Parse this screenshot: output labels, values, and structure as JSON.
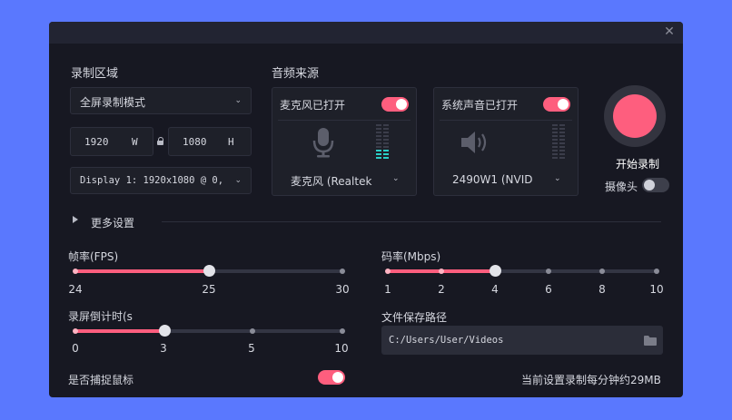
{
  "window": {
    "close_icon": "close-icon"
  },
  "record_area": {
    "title": "录制区域",
    "mode": "全屏录制模式",
    "width": "1920",
    "width_unit": "W",
    "height": "1080",
    "height_unit": "H",
    "display": "Display 1: 1920x1080 @ 0,"
  },
  "audio": {
    "title": "音频来源",
    "mic": {
      "label": "麦克风已打开",
      "device": "麦克风 (Realtek",
      "enabled": true
    },
    "system": {
      "label": "系统声音已打开",
      "device": "2490W1 (NVID",
      "enabled": true
    }
  },
  "record": {
    "button_label": "开始录制",
    "camera_label": "摄像头",
    "camera_enabled": false
  },
  "more_settings": "更多设置",
  "fps": {
    "label": "帧率(FPS)",
    "ticks": [
      "24",
      "25",
      "30"
    ],
    "value": 25
  },
  "bitrate": {
    "label": "码率(Mbps)",
    "ticks": [
      "1",
      "2",
      "4",
      "6",
      "8",
      "10"
    ],
    "value": 4
  },
  "countdown": {
    "label": "录屏倒计时(s",
    "ticks": [
      "0",
      "3",
      "5",
      "10"
    ],
    "value": 3
  },
  "save_path": {
    "label": "文件保存路径",
    "value": "C:/Users/User/Videos"
  },
  "capture_mouse": {
    "label": "是否捕捉鼠标",
    "enabled": true
  },
  "estimate": "当前设置录制每分钟约29MB",
  "colors": {
    "accent": "#fe5e7e",
    "background": "#5a78fe",
    "panel": "#171822",
    "meter": "#2ad0c7"
  }
}
